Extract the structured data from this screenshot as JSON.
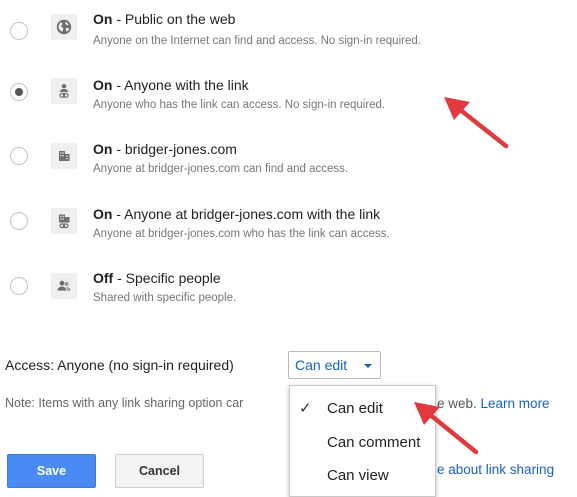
{
  "options": [
    {
      "bold": "On",
      "title": " - Public on the web",
      "desc": "Anyone on the Internet can find and access. No sign-in required.",
      "icon": "globe-icon",
      "selected": false
    },
    {
      "bold": "On",
      "title": " - Anyone with the link",
      "desc": "Anyone who has the link can access. No sign-in required.",
      "icon": "person-link-icon",
      "selected": true
    },
    {
      "bold": "On",
      "title": " - bridger-jones.com",
      "desc": "Anyone at bridger-jones.com can find and access.",
      "icon": "building-icon",
      "selected": false
    },
    {
      "bold": "On",
      "title": " - Anyone at bridger-jones.com with the link",
      "desc": "Anyone at bridger-jones.com who has the link can access.",
      "icon": "building-link-icon",
      "selected": false
    },
    {
      "bold": "Off",
      "title": " - Specific people",
      "desc": "Shared with specific people.",
      "icon": "people-icon",
      "selected": false
    }
  ],
  "access": {
    "label": "Access:  Anyone (no sign-in required)",
    "selected": "Can edit"
  },
  "note": {
    "text": "Note: Items with any link sharing option car",
    "tail": "e web. ",
    "learn_more": "Learn more",
    "learn_about": "e about link sharing"
  },
  "menu": {
    "items": [
      "Can edit",
      "Can comment",
      "Can view"
    ],
    "checked": "✓"
  },
  "buttons": {
    "save": "Save",
    "cancel": "Cancel"
  },
  "colors": {
    "accent": "#1a61c7",
    "save": "#4a8af4",
    "annotation": "#e0393e"
  }
}
